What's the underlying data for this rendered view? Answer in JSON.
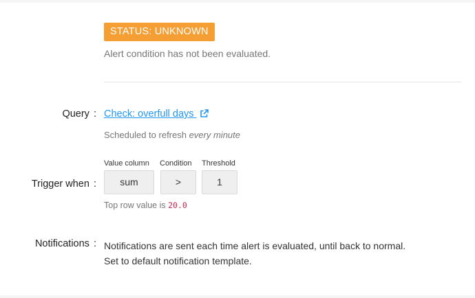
{
  "status": {
    "badge": "STATUS: UNKNOWN",
    "description": "Alert condition has not been evaluated.",
    "badge_color": "#f49e34"
  },
  "query": {
    "label": "Query",
    "colon": ":",
    "link_text": "Check: overfull days",
    "link_icon": "external-link-icon",
    "schedule_prefix": "Scheduled to refresh ",
    "schedule_value": "every minute"
  },
  "trigger": {
    "label": "Trigger when",
    "colon": ":",
    "value_column_label": "Value column",
    "value_column": "sum",
    "condition_label": "Condition",
    "condition": ">",
    "threshold_label": "Threshold",
    "threshold": "1",
    "top_row_prefix": "Top row value is ",
    "top_row_value": "20.0"
  },
  "notifications": {
    "label": "Notifications",
    "colon": ":",
    "line1": "Notifications are sent each time alert is evaluated, until back to normal.",
    "line2": "Set to default notification template."
  }
}
